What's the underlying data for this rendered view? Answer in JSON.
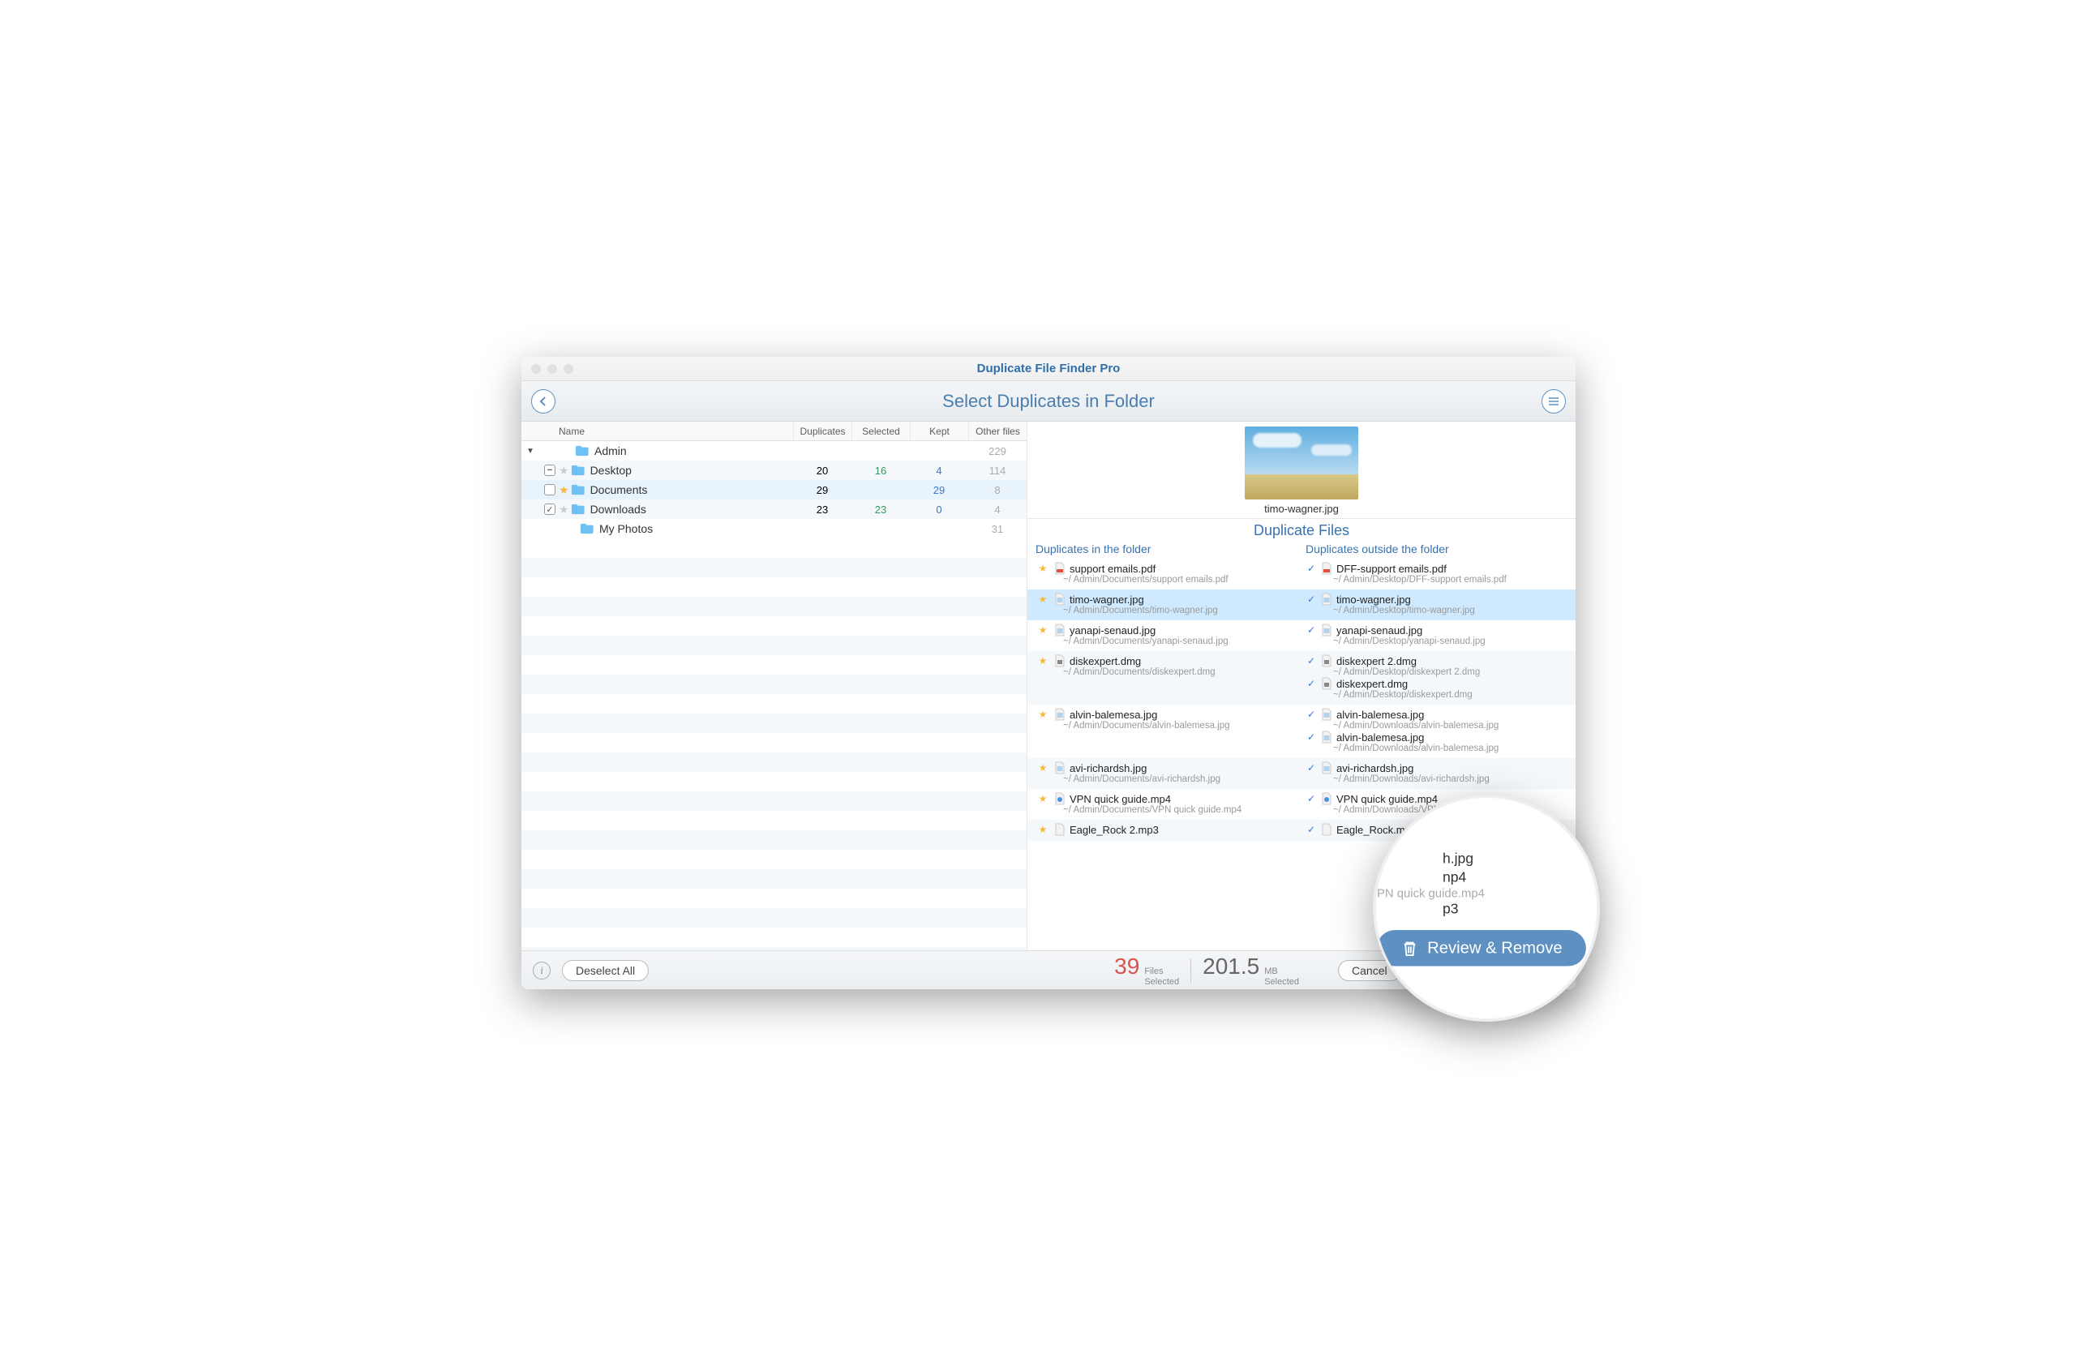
{
  "window": {
    "title": "Duplicate File Finder Pro"
  },
  "toolbar": {
    "subtitle": "Select Duplicates in Folder"
  },
  "columns": {
    "name": "Name",
    "duplicates": "Duplicates",
    "selected": "Selected",
    "kept": "Kept",
    "other": "Other files"
  },
  "tree": [
    {
      "name": "Admin",
      "level": 0,
      "expanded": true,
      "other": "229"
    },
    {
      "name": "Desktop",
      "level": 1,
      "check": "indet",
      "star": false,
      "dup": "20",
      "sel": "16",
      "kept": "4",
      "other": "114"
    },
    {
      "name": "Documents",
      "level": 1,
      "check": "none",
      "star": true,
      "highlight": true,
      "dup": "29",
      "sel": "",
      "kept": "29",
      "other": "8"
    },
    {
      "name": "Downloads",
      "level": 1,
      "check": "checked",
      "star": false,
      "dup": "23",
      "sel": "23",
      "kept": "0",
      "other": "4"
    },
    {
      "name": "My Photos",
      "level": 1,
      "nocb": true,
      "other": "31"
    }
  ],
  "preview": {
    "filename": "timo-wagner.jpg"
  },
  "dup": {
    "title": "Duplicate Files",
    "h_in": "Duplicates in the folder",
    "h_out": "Duplicates outside the folder"
  },
  "rows": [
    {
      "in": [
        {
          "name": "support emails.pdf",
          "path": "~/ Admin/Documents/support emails.pdf",
          "mark": "star",
          "icon": "pdf"
        }
      ],
      "out": [
        {
          "name": "DFF-support emails.pdf",
          "path": "~/ Admin/Desktop/DFF-support emails.pdf",
          "mark": "check",
          "icon": "pdf"
        }
      ]
    },
    {
      "highlight": true,
      "in": [
        {
          "name": "timo-wagner.jpg",
          "path": "~/ Admin/Documents/timo-wagner.jpg",
          "mark": "star",
          "icon": "img"
        }
      ],
      "out": [
        {
          "name": "timo-wagner.jpg",
          "path": "~/ Admin/Desktop/timo-wagner.jpg",
          "mark": "check",
          "icon": "img"
        }
      ]
    },
    {
      "in": [
        {
          "name": "yanapi-senaud.jpg",
          "path": "~/ Admin/Documents/yanapi-senaud.jpg",
          "mark": "star",
          "icon": "img"
        }
      ],
      "out": [
        {
          "name": "yanapi-senaud.jpg",
          "path": "~/ Admin/Desktop/yanapi-senaud.jpg",
          "mark": "check",
          "icon": "img"
        }
      ]
    },
    {
      "in": [
        {
          "name": "diskexpert.dmg",
          "path": "~/ Admin/Documents/diskexpert.dmg",
          "mark": "star",
          "icon": "dmg"
        }
      ],
      "out": [
        {
          "name": "diskexpert 2.dmg",
          "path": "~/ Admin/Desktop/diskexpert 2.dmg",
          "mark": "check",
          "icon": "dmg"
        },
        {
          "name": "diskexpert.dmg",
          "path": "~/ Admin/Desktop/diskexpert.dmg",
          "mark": "check",
          "icon": "dmg"
        }
      ]
    },
    {
      "in": [
        {
          "name": "alvin-balemesa.jpg",
          "path": "~/ Admin/Documents/alvin-balemesa.jpg",
          "mark": "star",
          "icon": "img"
        }
      ],
      "out": [
        {
          "name": "alvin-balemesa.jpg",
          "path": "~/ Admin/Downloads/alvin-balemesa.jpg",
          "mark": "check",
          "icon": "img"
        },
        {
          "name": "alvin-balemesa.jpg",
          "path": "~/ Admin/Downloads/alvin-balemesa.jpg",
          "mark": "check",
          "icon": "img"
        }
      ]
    },
    {
      "in": [
        {
          "name": "avi-richardsh.jpg",
          "path": "~/ Admin/Documents/avi-richardsh.jpg",
          "mark": "star",
          "icon": "img"
        }
      ],
      "out": [
        {
          "name": "avi-richardsh.jpg",
          "path": "~/ Admin/Downloads/avi-richardsh.jpg",
          "mark": "check",
          "icon": "img"
        }
      ]
    },
    {
      "in": [
        {
          "name": "VPN quick guide.mp4",
          "path": "~/ Admin/Documents/VPN quick guide.mp4",
          "mark": "star",
          "icon": "vid"
        }
      ],
      "out": [
        {
          "name": "VPN quick guide.mp4",
          "path": "~/ Admin/Downloads/VPN quick guide.mp4",
          "mark": "check",
          "icon": "vid"
        }
      ]
    },
    {
      "in": [
        {
          "name": "Eagle_Rock 2.mp3",
          "path": "",
          "mark": "star",
          "icon": "aud"
        }
      ],
      "out": [
        {
          "name": "Eagle_Rock.mp3",
          "path": "",
          "mark": "check",
          "icon": "aud"
        }
      ]
    }
  ],
  "footer": {
    "deselect": "Deselect All",
    "files_n": "39",
    "files_l1": "Files",
    "files_l2": "Selected",
    "size_n": "201.5",
    "size_l1": "MB",
    "size_l2": "Selected",
    "cancel": "Cancel",
    "review": "Review & Remove"
  },
  "mag": {
    "l1": "h.jpg",
    "l2": "np4",
    "l2b": "PN quick guide.mp4",
    "l3": "p3",
    "btn": "Review & Remove"
  }
}
